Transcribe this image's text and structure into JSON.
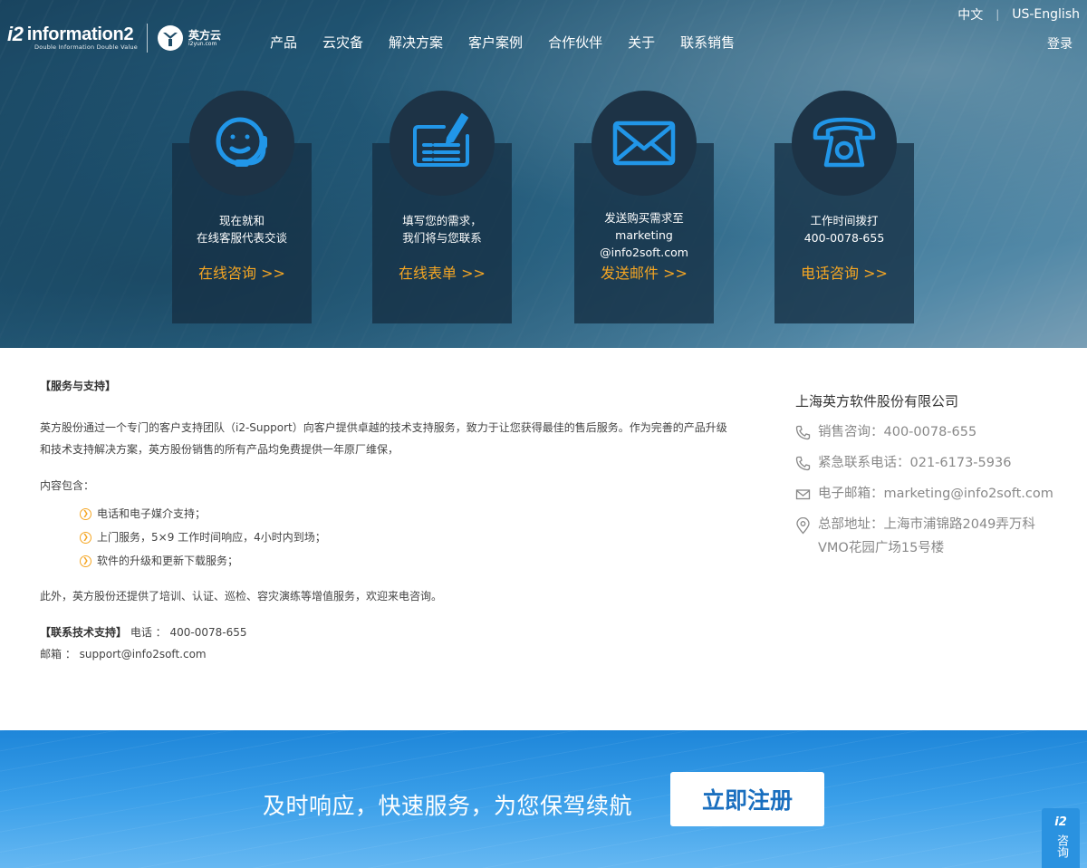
{
  "logo": {
    "mark": "i2",
    "brand": "information2",
    "tagline": "Double Information Double Value",
    "partner_cn": "英方云",
    "partner_domain": "i2yun.com"
  },
  "nav": {
    "items": [
      "产品",
      "云灾备",
      "解决方案",
      "客户案例",
      "合作伙伴",
      "关于",
      "联系销售"
    ]
  },
  "header": {
    "lang_cn": "中文",
    "lang_sep": "|",
    "lang_en": "US-English",
    "login": "登录"
  },
  "cards": [
    {
      "line1": "现在就和",
      "line2": "在线客服代表交谈",
      "link": "在线咨询 >>",
      "icon": "headset-icon"
    },
    {
      "line1": "填写您的需求，",
      "line2": "我们将与您联系",
      "link": "在线表单 >>",
      "icon": "form-pen-icon"
    },
    {
      "line1": "发送购买需求至",
      "line2": "marketing",
      "line3": "@info2soft.com",
      "link": "发送邮件 >>",
      "icon": "envelope-icon"
    },
    {
      "line1": "工作时间拨打",
      "line2": "400-0078-655",
      "link": "电话咨询 >>",
      "icon": "telephone-icon"
    }
  ],
  "content": {
    "title": "【服务与支持】",
    "intro": "英方股份通过一个专门的客户支持团队（i2-Support）向客户提供卓越的技术支持服务，致力于让您获得最佳的售后服务。作为完善的产品升级和技术支持解决方案，英方股份销售的所有产品均免费提供一年原厂维保，",
    "includes_label": "内容包含：",
    "includes": [
      "电话和电子媒介支持；",
      "上门服务，5×9 工作时间响应，4小时内到场；",
      "软件的升级和更新下载服务；"
    ],
    "extra": "此外，英方股份还提供了培训、认证、巡检、容灾演练等增值服务，欢迎来电咨询。",
    "support_label": "【联系技术支持】",
    "support_phone": "电话 ： 400-0078-655",
    "support_email": "邮箱 ： support@info2soft.com"
  },
  "side": {
    "company": "上海英方软件股份有限公司",
    "sales": "销售咨询：400-0078-655",
    "emergency": "紧急联系电话：021-6173-5936",
    "email": "电子邮箱：marketing@info2soft.com",
    "address_line1": "总部地址：上海市浦锦路2049弄万科",
    "address_line2": "VMO花园广场15号楼"
  },
  "banner": {
    "slogan": "及时响应，快速服务，为您保驾续航",
    "register": "立即注册"
  },
  "float": {
    "mark": "i2",
    "label": "咨询"
  },
  "colors": {
    "accent_orange": "#f5a623",
    "brand_blue": "#1a6fbf",
    "icon_blue": "#2196e8"
  }
}
